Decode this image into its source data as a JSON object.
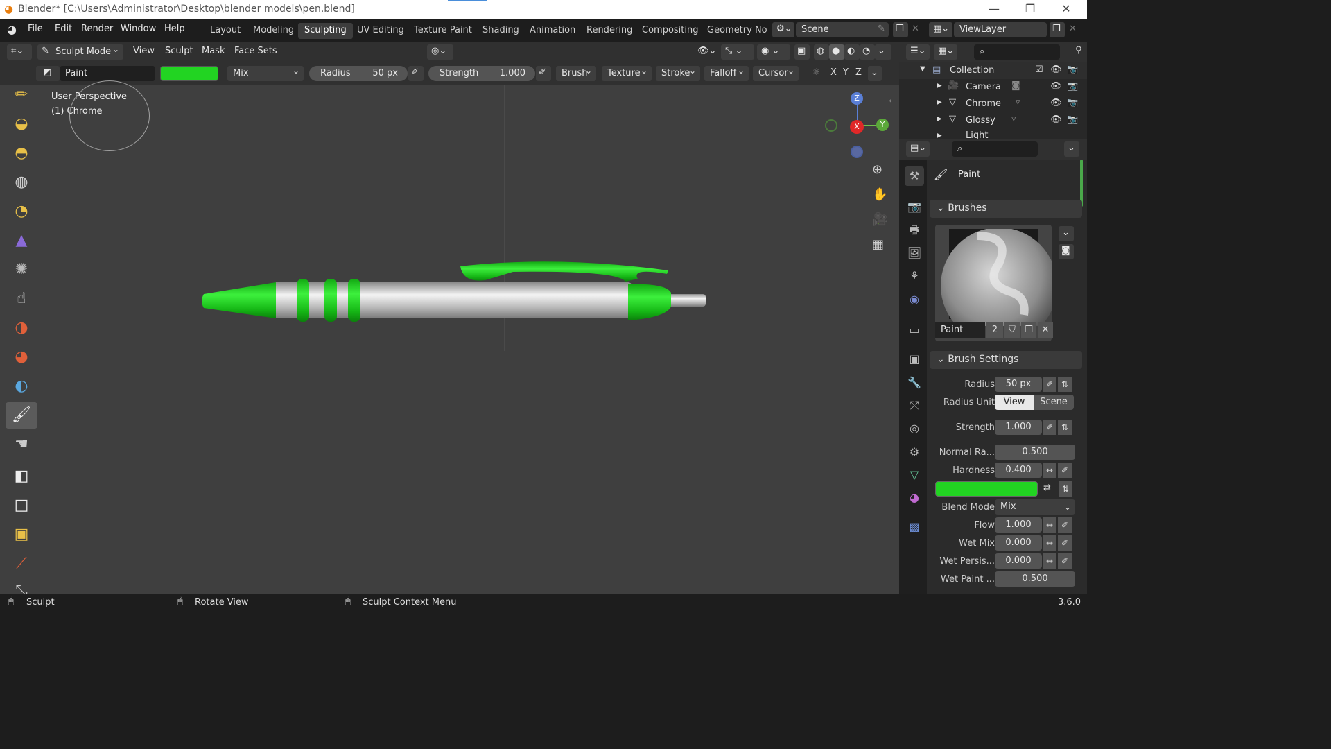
{
  "window": {
    "title": "Blender* [C:\\Users\\Administrator\\Desktop\\blender models\\pen.blend]",
    "minimize": "—",
    "maximize": "❐",
    "close": "✕"
  },
  "menus": [
    "File",
    "Edit",
    "Render",
    "Window",
    "Help"
  ],
  "workspaces": [
    "Layout",
    "Modeling",
    "Sculpting",
    "UV Editing",
    "Texture Paint",
    "Shading",
    "Animation",
    "Rendering",
    "Compositing",
    "Geometry Noc"
  ],
  "active_workspace": "Sculpting",
  "scene": "Scene",
  "view_layer": "ViewLayer",
  "header": {
    "mode": "Sculpt Mode",
    "menus": [
      "View",
      "Sculpt",
      "Mask",
      "Face Sets"
    ]
  },
  "tool_settings": {
    "brush": "Paint",
    "color": "#22d422",
    "blend": "Mix",
    "radius_label": "Radius",
    "radius": "50 px",
    "strength_label": "Strength",
    "strength": "1.000",
    "popovers": [
      "Brush",
      "Texture",
      "Stroke",
      "Falloff",
      "Cursor"
    ],
    "axes": [
      "X",
      "Y",
      "Z"
    ]
  },
  "viewport": {
    "line1": "User Perspective",
    "line2": "(1) Chrome"
  },
  "gizmo": {
    "z": "Z",
    "x": "X",
    "y": "Y"
  },
  "outliner": {
    "collection": "Collection",
    "items": [
      "Camera",
      "Chrome",
      "Glossy",
      "Light"
    ]
  },
  "properties": {
    "tool_name": "Paint",
    "brushes_header": "Brushes",
    "brush_name": "Paint",
    "brush_users": "2",
    "brush_settings_header": "Brush Settings",
    "radius_label": "Radius",
    "radius": "50 px",
    "radius_unit_label": "Radius Unit",
    "radius_unit_view": "View",
    "radius_unit_scene": "Scene",
    "strength_label": "Strength",
    "strength": "1.000",
    "normal_radius_label": "Normal Ra...",
    "normal_radius": "0.500",
    "hardness_label": "Hardness",
    "hardness": "0.400",
    "blend_label": "Blend Mode",
    "blend": "Mix",
    "flow_label": "Flow",
    "flow": "1.000",
    "wetmix_label": "Wet Mix",
    "wetmix": "0.000",
    "wetpersist_label": "Wet Persis...",
    "wetpersist": "0.000",
    "wetpaint_label": "Wet Paint ...",
    "wetpaint": "0.500"
  },
  "status": {
    "left": "Sculpt",
    "mid": "Rotate View",
    "right": "Sculpt Context Menu",
    "version": "3.6.0"
  },
  "colors": {
    "brush": "#22d422",
    "accent": "#4a8eda"
  }
}
